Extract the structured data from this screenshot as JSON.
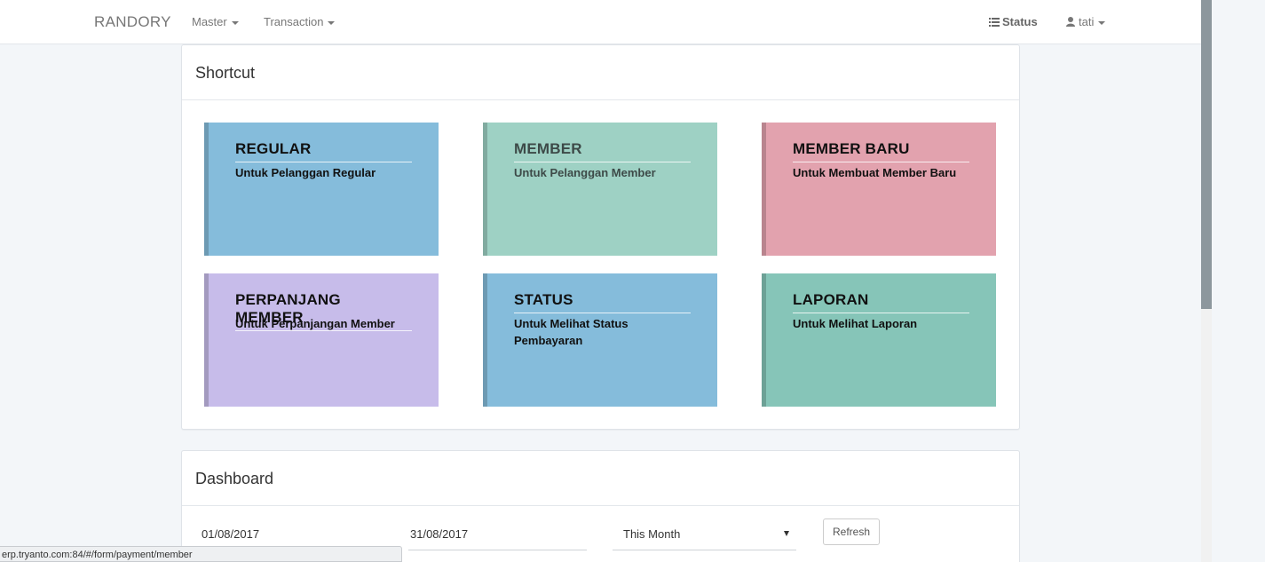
{
  "navbar": {
    "brand": "RANDORY",
    "menu": [
      {
        "label": "Master"
      },
      {
        "label": "Transaction"
      }
    ],
    "status_label": "Status",
    "user_label": "tati"
  },
  "shortcut": {
    "title": "Shortcut",
    "tiles": [
      {
        "title": "REGULAR",
        "desc": "Untuk Pelanggan Regular",
        "color": "#85bcdb"
      },
      {
        "title": "MEMBER",
        "desc": "Untuk Pelanggan Member",
        "color": "#9ed1c4"
      },
      {
        "title": "MEMBER BARU",
        "desc": "Untuk Membuat Member Baru",
        "color": "#e2a2ae"
      },
      {
        "title": "PERPANJANG MEMBER",
        "desc": "Untuk Perpanjangan Member",
        "color": "#c7bcea"
      },
      {
        "title": "STATUS",
        "desc": "Untuk Melihat Status Pembayaran",
        "color": "#85bcdb"
      },
      {
        "title": "LAPORAN",
        "desc": "Untuk Melihat Laporan",
        "color": "#86c5b8"
      }
    ]
  },
  "dashboard": {
    "title": "Dashboard",
    "start_date": "01/08/2017",
    "end_date": "31/08/2017",
    "period": "This Month",
    "refresh_label": "Refresh"
  },
  "statusbar": {
    "url": "erp.tryanto.com:84/#/form/payment/member"
  }
}
